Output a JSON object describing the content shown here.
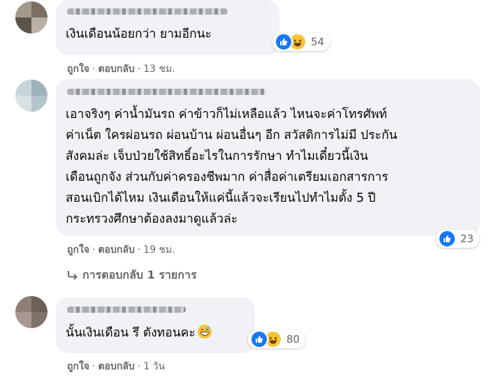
{
  "comments": [
    {
      "text_lines": [
        "เงินเดือนน้อยกว่า ยามอีกนะ"
      ],
      "reactions": {
        "icons": [
          "like-icon",
          "haha-icon"
        ],
        "count": "54"
      },
      "meta": {
        "like": "ถูกใจ",
        "reply": "ตอบกลับ",
        "time": "13 ชม."
      }
    },
    {
      "text_lines": [
        "เอาจริงๆ ค่าน้ำมันรถ ค่าข้าวก็ไม่เหลือแล้ว ไหนจะค่าโทรศัพท์",
        "ค่าเน็ต ใครผ่อนรถ ผ่อนบ้าน ผ่อนอื่นๆ อีก สวัสดิการไม่มี ประกัน",
        "สังคมล่ะ เจ็บป่วยใช้สิทธิ์อะไรในการรักษา ทำไมเดี๋ยวนี้เงิน",
        "เดือนถูกจัง ส่วนกับค่าครองชีพมาก ค่าสื่อค่าเตรียมเอกสารการ",
        "สอนเบิกได้ไหม เงินเดือนให้แค่นี้แล้วจะเรียนไปทำไมตั้ง 5 ปี",
        "กระทรวงศึกษาต้องลงมาดูแล้วล่ะ"
      ],
      "reactions": {
        "icons": [
          "like-icon"
        ],
        "count": "23"
      },
      "meta": {
        "like": "ถูกใจ",
        "reply": "ตอบกลับ",
        "time": "19 ชม."
      },
      "replies_link": "การตอบกลับ 1 รายการ"
    },
    {
      "text_lines": [
        "นั้นเงินเดือน รึ ตังทอนคะ"
      ],
      "trailing_emoji": "grinning-sweat-emoji",
      "reactions": {
        "icons": [
          "like-icon",
          "haha-icon"
        ],
        "count": "80"
      },
      "meta": {
        "like": "ถูกใจ",
        "reply": "ตอบกลับ",
        "time": "1 วัน"
      }
    }
  ],
  "colors": {
    "bubble": "#f0f2f5",
    "meta_text": "#65676b",
    "like_blue": "#1877f2",
    "haha_yellow": "#f7c33b"
  }
}
